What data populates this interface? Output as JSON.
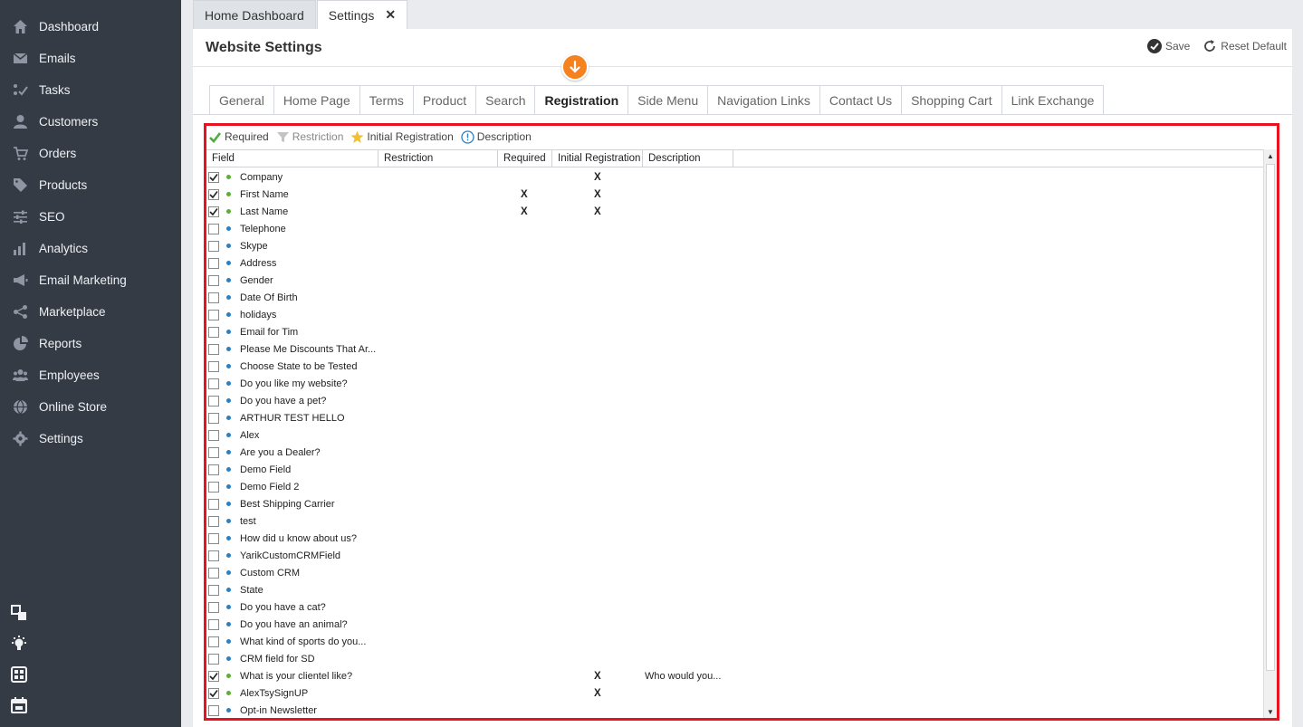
{
  "sidebar": {
    "items": [
      {
        "label": "Dashboard",
        "icon": "home-icon"
      },
      {
        "label": "Emails",
        "icon": "envelope-icon"
      },
      {
        "label": "Tasks",
        "icon": "tasks-icon"
      },
      {
        "label": "Customers",
        "icon": "user-icon"
      },
      {
        "label": "Orders",
        "icon": "cart-icon"
      },
      {
        "label": "Products",
        "icon": "tag-icon"
      },
      {
        "label": "SEO",
        "icon": "sliders-icon"
      },
      {
        "label": "Analytics",
        "icon": "bar-chart-icon"
      },
      {
        "label": "Email Marketing",
        "icon": "megaphone-icon"
      },
      {
        "label": "Marketplace",
        "icon": "share-icon"
      },
      {
        "label": "Reports",
        "icon": "pie-chart-icon"
      },
      {
        "label": "Employees",
        "icon": "group-icon"
      },
      {
        "label": "Online Store",
        "icon": "globe-icon"
      },
      {
        "label": "Settings",
        "icon": "gear-icon"
      }
    ]
  },
  "top_tabs": {
    "home": "Home Dashboard",
    "settings": "Settings",
    "close": "✕"
  },
  "header": {
    "title": "Website Settings",
    "save": "Save",
    "reset": "Reset Default"
  },
  "settings_tabs": [
    "General",
    "Home Page",
    "Terms",
    "Product",
    "Search",
    "Registration",
    "Side Menu",
    "Navigation Links",
    "Contact Us",
    "Shopping Cart",
    "Link Exchange"
  ],
  "active_tab": "Registration",
  "legend": {
    "required": "Required",
    "restriction": "Restriction",
    "initial": "Initial Registration",
    "description": "Description"
  },
  "columns": {
    "field": "Field",
    "restriction": "Restriction",
    "required": "Required",
    "initial": "Initial Registration",
    "description": "Description"
  },
  "colors": {
    "sidebar": "#353b45",
    "highlight": "#e8131e",
    "accent": "#f5811f",
    "dot_green": "#5cae34",
    "dot_blue": "#2c7fc0"
  },
  "rows": [
    {
      "name": "Company",
      "checked": true,
      "dot": "green",
      "required": "",
      "initial": "X",
      "description": ""
    },
    {
      "name": "First Name",
      "checked": true,
      "dot": "green",
      "required": "X",
      "initial": "X",
      "description": ""
    },
    {
      "name": "Last Name",
      "checked": true,
      "dot": "green",
      "required": "X",
      "initial": "X",
      "description": ""
    },
    {
      "name": "Telephone",
      "checked": false,
      "dot": "blue",
      "required": "",
      "initial": "",
      "description": ""
    },
    {
      "name": "Skype",
      "checked": false,
      "dot": "blue",
      "required": "",
      "initial": "",
      "description": ""
    },
    {
      "name": "Address",
      "checked": false,
      "dot": "blue",
      "required": "",
      "initial": "",
      "description": ""
    },
    {
      "name": "Gender",
      "checked": false,
      "dot": "blue",
      "required": "",
      "initial": "",
      "description": ""
    },
    {
      "name": "Date Of Birth",
      "checked": false,
      "dot": "blue",
      "required": "",
      "initial": "",
      "description": ""
    },
    {
      "name": "holidays",
      "checked": false,
      "dot": "blue",
      "required": "",
      "initial": "",
      "description": ""
    },
    {
      "name": "Email for Tim",
      "checked": false,
      "dot": "blue",
      "required": "",
      "initial": "",
      "description": ""
    },
    {
      "name": "Please Me Discounts That Ar...",
      "checked": false,
      "dot": "blue",
      "required": "",
      "initial": "",
      "description": ""
    },
    {
      "name": "Choose State to be Tested",
      "checked": false,
      "dot": "blue",
      "required": "",
      "initial": "",
      "description": ""
    },
    {
      "name": "Do you like my website?",
      "checked": false,
      "dot": "blue",
      "required": "",
      "initial": "",
      "description": ""
    },
    {
      "name": "Do you have a pet?",
      "checked": false,
      "dot": "blue",
      "required": "",
      "initial": "",
      "description": ""
    },
    {
      "name": "ARTHUR TEST HELLO",
      "checked": false,
      "dot": "blue",
      "required": "",
      "initial": "",
      "description": ""
    },
    {
      "name": "Alex",
      "checked": false,
      "dot": "blue",
      "required": "",
      "initial": "",
      "description": ""
    },
    {
      "name": "Are you a Dealer?",
      "checked": false,
      "dot": "blue",
      "required": "",
      "initial": "",
      "description": ""
    },
    {
      "name": "Demo Field",
      "checked": false,
      "dot": "blue",
      "required": "",
      "initial": "",
      "description": ""
    },
    {
      "name": "Demo Field 2",
      "checked": false,
      "dot": "blue",
      "required": "",
      "initial": "",
      "description": ""
    },
    {
      "name": "Best Shipping Carrier",
      "checked": false,
      "dot": "blue",
      "required": "",
      "initial": "",
      "description": ""
    },
    {
      "name": "test",
      "checked": false,
      "dot": "blue",
      "required": "",
      "initial": "",
      "description": ""
    },
    {
      "name": "How did u know about us?",
      "checked": false,
      "dot": "blue",
      "required": "",
      "initial": "",
      "description": ""
    },
    {
      "name": "YarikCustomCRMField",
      "checked": false,
      "dot": "blue",
      "required": "",
      "initial": "",
      "description": ""
    },
    {
      "name": "Custom CRM",
      "checked": false,
      "dot": "blue",
      "required": "",
      "initial": "",
      "description": ""
    },
    {
      "name": "State",
      "checked": false,
      "dot": "blue",
      "required": "",
      "initial": "",
      "description": ""
    },
    {
      "name": "Do you have a cat?",
      "checked": false,
      "dot": "blue",
      "required": "",
      "initial": "",
      "description": ""
    },
    {
      "name": "Do you have an animal?",
      "checked": false,
      "dot": "blue",
      "required": "",
      "initial": "",
      "description": ""
    },
    {
      "name": "What kind of sports do you...",
      "checked": false,
      "dot": "blue",
      "required": "",
      "initial": "",
      "description": ""
    },
    {
      "name": "CRM field for SD",
      "checked": false,
      "dot": "blue",
      "required": "",
      "initial": "",
      "description": ""
    },
    {
      "name": "What is your clientel like?",
      "checked": true,
      "dot": "green",
      "required": "",
      "initial": "X",
      "description": "Who would you..."
    },
    {
      "name": "AlexTsySignUP",
      "checked": true,
      "dot": "green",
      "required": "",
      "initial": "X",
      "description": ""
    },
    {
      "name": "Opt-in Newsletter",
      "checked": false,
      "dot": "blue",
      "required": "",
      "initial": "",
      "description": ""
    }
  ]
}
